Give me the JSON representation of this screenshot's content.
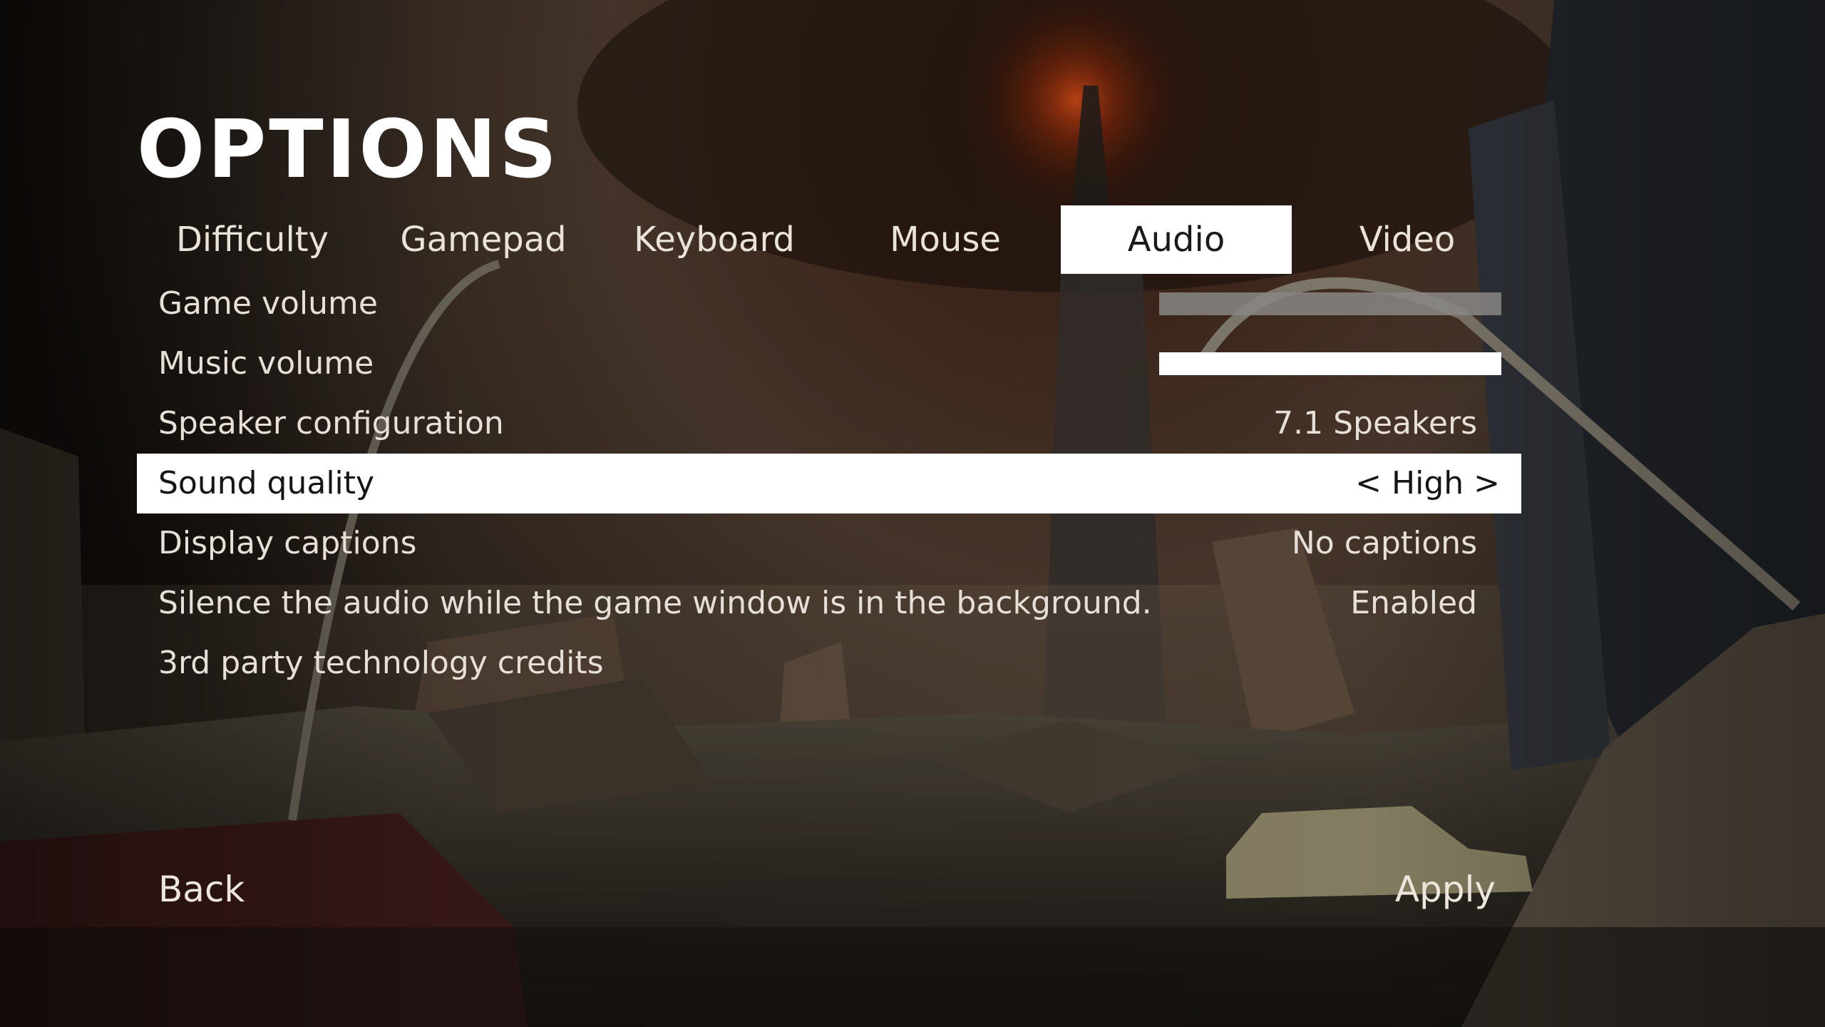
{
  "title": "OPTIONS",
  "tabs": [
    {
      "label": "Difficulty",
      "active": false
    },
    {
      "label": "Gamepad",
      "active": false
    },
    {
      "label": "Keyboard",
      "active": false
    },
    {
      "label": "Mouse",
      "active": false
    },
    {
      "label": "Audio",
      "active": true
    },
    {
      "label": "Video",
      "active": false
    }
  ],
  "settings": {
    "game_volume": {
      "label": "Game volume",
      "level": 1.0,
      "fill_color": "#8a8784"
    },
    "music_volume": {
      "label": "Music volume",
      "level": 1.0,
      "fill_color": "#ffffff"
    },
    "speaker_configuration": {
      "label": "Speaker configuration",
      "value": "7.1 Speakers"
    },
    "sound_quality": {
      "label": "Sound quality",
      "value": "< High >",
      "selected": true
    },
    "display_captions": {
      "label": "Display captions",
      "value": "No captions"
    },
    "silence_background": {
      "label": "Silence the audio while the game window is in the background.",
      "value": "Enabled"
    },
    "credits": {
      "label": "3rd party technology credits"
    }
  },
  "footer": {
    "back_label": "Back",
    "apply_label": "Apply"
  },
  "colors": {
    "highlight": "#ffffff",
    "text": "#e6e0d8",
    "selected_text": "#151515"
  }
}
